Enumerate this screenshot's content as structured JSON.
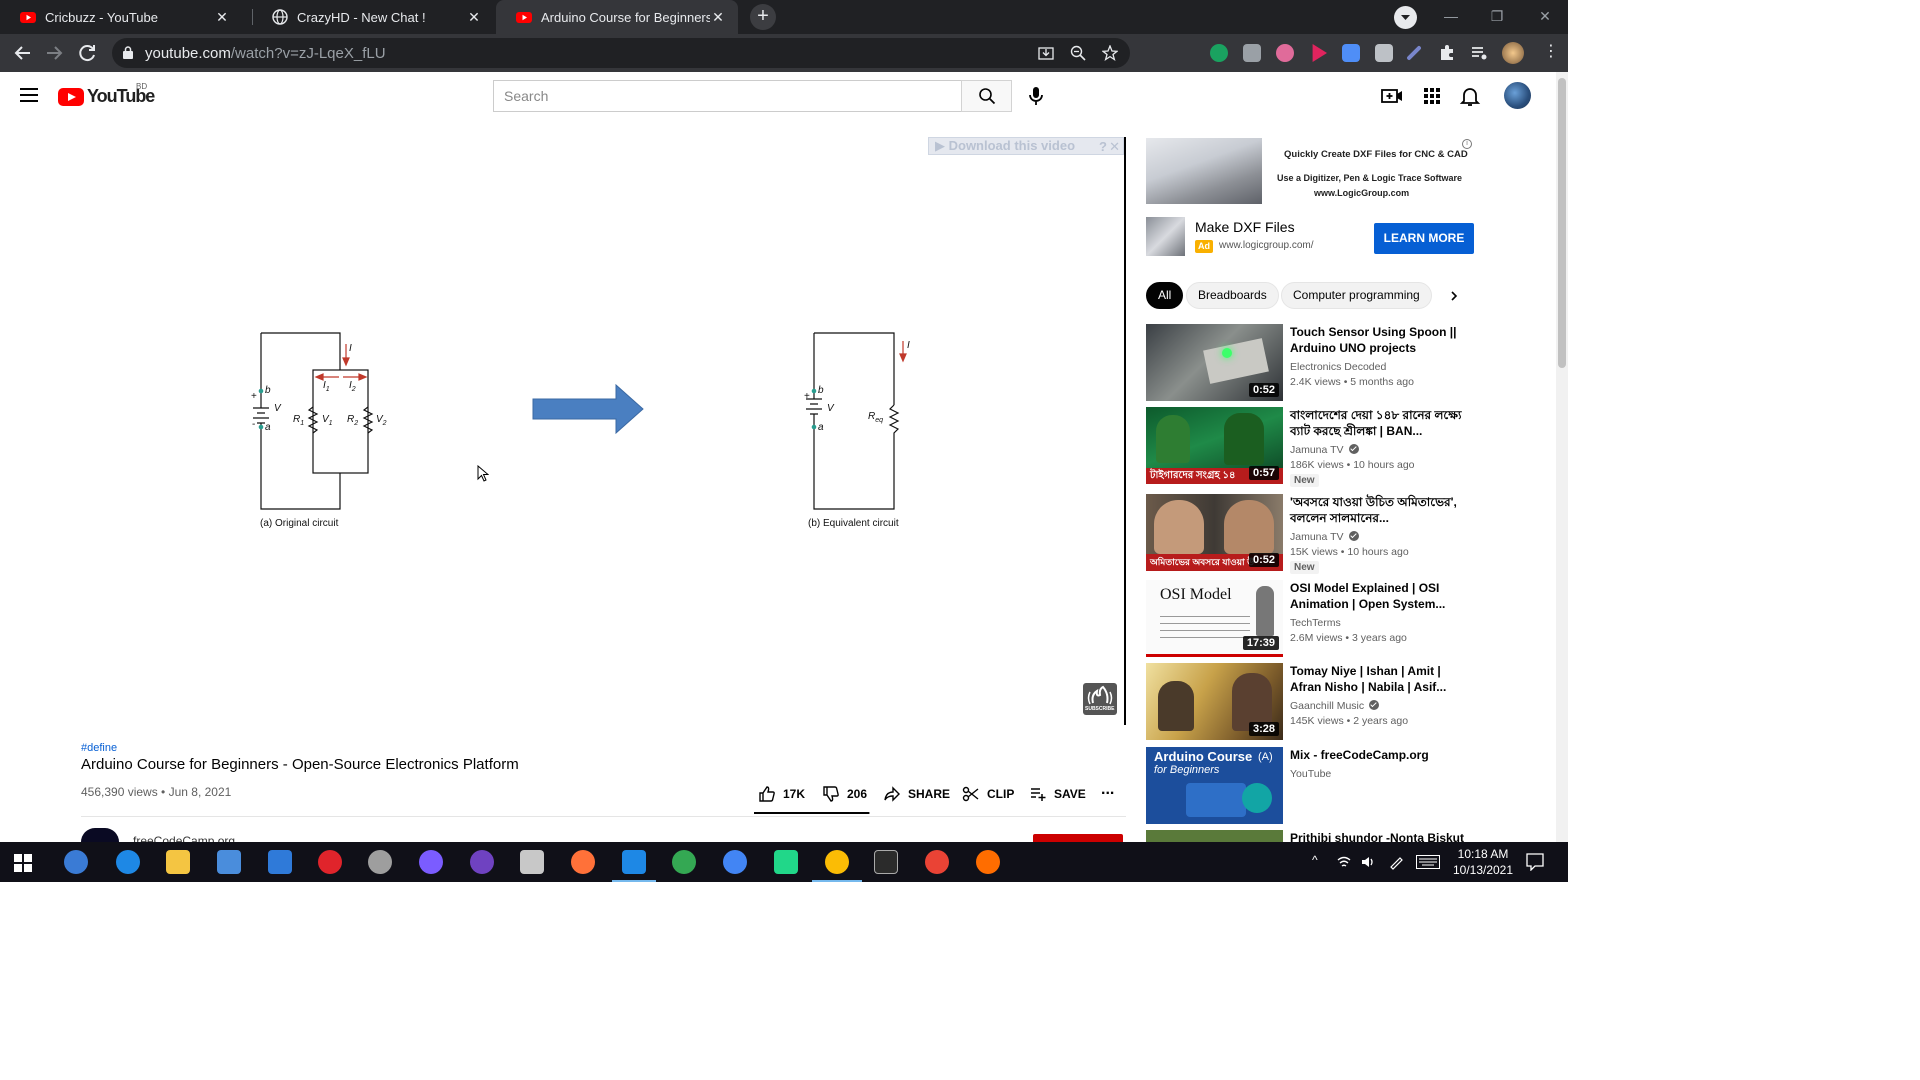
{
  "browser": {
    "tabs": [
      {
        "title": "Cricbuzz - YouTube",
        "icon": "youtube-icon"
      },
      {
        "title": "CrazyHD - New Chat !",
        "icon": "globe-icon"
      },
      {
        "title": "Arduino Course for Beginners - O",
        "icon": "youtube-icon"
      }
    ],
    "url_host": "youtube.com",
    "url_path": "/watch?v=zJ-LqeX_fLU"
  },
  "youtube": {
    "logo_text": "YouTube",
    "country_code": "BD",
    "search_placeholder": "Search"
  },
  "player": {
    "download_bar": "▶ Download this video",
    "download_help": "?",
    "download_close": "✕",
    "circuit_labels": {
      "caption_a": "(a) Original circuit",
      "caption_b": "(b) Equivalent circuit",
      "b": "b",
      "a": "a",
      "V": "V",
      "I": "I",
      "I1": "I",
      "I1_sub": "1",
      "I2": "I",
      "I2_sub": "2",
      "R1": "R",
      "R1_sub": "1",
      "V1": "V",
      "V1_sub": "1",
      "R2": "R",
      "R2_sub": "2",
      "V2": "V",
      "V2_sub": "2",
      "Req": "R",
      "Req_sub": "eq",
      "plus": "+",
      "minus": "-"
    },
    "watermark": "SUBSCRIBE"
  },
  "video": {
    "hashtag": "#define",
    "title": "Arduino Course for Beginners - Open-Source Electronics Platform",
    "meta": "456,390 views • Jun 8, 2021",
    "likes": "17K",
    "dislikes": "206",
    "share": "SHARE",
    "clip": "CLIP",
    "save": "SAVE",
    "more": "...",
    "channel_peek": "freeCodeCamp.org",
    "like_ratio": 0.988
  },
  "ad": {
    "banner_line1": "Quickly Create DXF Files for CNC & CAD",
    "banner_line2": "Use a Digitizer, Pen & Logic Trace Software",
    "banner_line3": "www.LogicGroup.com",
    "info": "i",
    "title": "Make DXF Files",
    "badge": "Ad",
    "url": "www.logicgroup.com/",
    "cta": "LEARN MORE"
  },
  "chips": [
    "All",
    "Breadboards",
    "Computer programming"
  ],
  "recommendations": [
    {
      "title": "Touch Sensor Using Spoon || Arduino UNO projects",
      "channel": "Electronics Decoded",
      "verified": false,
      "meta": "2.4K views • 5 months ago",
      "duration": "0:52",
      "badge": ""
    },
    {
      "title": "বাংলাদেশের দেয়া ১৪৮ রানের লক্ষ্যে ব্যাট করছে শ্রীলঙ্কা | BAN...",
      "channel": "Jamuna TV",
      "verified": true,
      "meta": "186K views • 10 hours ago",
      "duration": "0:57",
      "badge": "New",
      "thumb_text": "টাইগারদের সংগ্রহ ১৪"
    },
    {
      "title": "'অবসরে যাওয়া উচিত অমিতাভের', বললেন সালমানের...",
      "channel": "Jamuna TV",
      "verified": true,
      "meta": "15K views • 10 hours ago",
      "duration": "0:52",
      "badge": "New",
      "thumb_text": "অমিতাভের অবসরে যাওয়া উ"
    },
    {
      "title": "OSI Model Explained | OSI Animation | Open System...",
      "channel": "TechTerms",
      "verified": false,
      "meta": "2.6M views • 3 years ago",
      "duration": "17:39",
      "badge": "",
      "thumb_text": "OSI Model"
    },
    {
      "title": "Tomay Niye | Ishan | Amit | Afran Nisho | Nabila | Asif...",
      "channel": "Gaanchill Music",
      "verified": true,
      "meta": "145K views • 2 years ago",
      "duration": "3:28",
      "badge": ""
    },
    {
      "title": "Mix - freeCodeCamp.org",
      "channel": "YouTube",
      "verified": false,
      "meta": "",
      "duration": "",
      "badge": "",
      "thumb_text": "Arduino Course",
      "thumb_text2": "for Beginners",
      "thumb_text3": "(A)"
    },
    {
      "title": "Prithibi shundor -Nonta Biskut",
      "channel": "",
      "verified": false,
      "meta": "",
      "duration": "",
      "badge": ""
    }
  ],
  "taskbar": {
    "time": "10:18 AM",
    "date": "10/13/2021"
  }
}
